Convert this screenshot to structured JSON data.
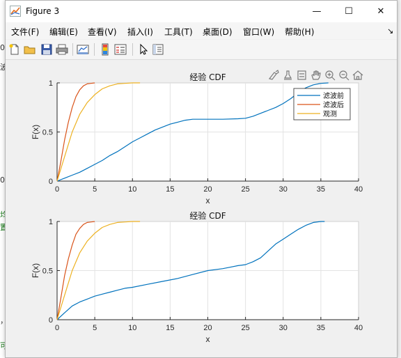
{
  "background": {
    "left_fragments": [
      "0",
      "波",
      "0",
      "均",
      "置",
      "，",
      "可"
    ]
  },
  "window": {
    "title": "Figure 3",
    "controls": {
      "minimize": "—",
      "maximize": "☐",
      "close": "✕"
    }
  },
  "menubar": {
    "items": [
      "文件(F)",
      "编辑(E)",
      "查看(V)",
      "插入(I)",
      "工具(T)",
      "桌面(D)",
      "窗口(W)",
      "帮助(H)"
    ],
    "overflow": "↘"
  },
  "toolbar": {
    "icons": [
      "new-figure-icon",
      "open-file-icon",
      "save-icon",
      "print-icon",
      "link-plot-icon",
      "insert-colorbar-icon",
      "insert-legend-icon",
      "edit-plot-arrow-icon",
      "property-inspector-icon"
    ]
  },
  "axes_toolbar": {
    "icons": [
      "brush-icon",
      "data-tips-icon",
      "zoom-select-icon",
      "pan-icon",
      "zoom-in-icon",
      "zoom-out-icon",
      "home-icon"
    ]
  },
  "colors": {
    "before": "#0072BD",
    "after": "#D95319",
    "observed": "#EDB120"
  },
  "chart_data": [
    {
      "type": "line",
      "title": "经验 CDF",
      "xlabel": "x",
      "ylabel": "F(x)",
      "xlim": [
        0,
        40
      ],
      "ylim": [
        0,
        1
      ],
      "xticks": [
        "0",
        "5",
        "10",
        "15",
        "20",
        "25",
        "30",
        "35",
        "40"
      ],
      "yticks": [
        "0",
        "0.5",
        "1"
      ],
      "grid": true,
      "legend": {
        "placement": "top-right",
        "entries": [
          "滤波前",
          "滤波后",
          "观测"
        ]
      },
      "series": [
        {
          "name": "滤波前",
          "color": "#0072BD",
          "x": [
            0,
            1,
            2,
            3,
            4,
            5,
            6,
            7,
            8,
            9,
            10,
            11,
            12,
            13,
            14,
            15,
            16,
            17,
            18,
            20,
            22,
            24,
            25,
            26,
            27,
            28,
            29,
            30,
            31,
            32,
            33,
            34,
            35,
            36
          ],
          "y": [
            0,
            0.03,
            0.06,
            0.09,
            0.13,
            0.17,
            0.21,
            0.26,
            0.3,
            0.35,
            0.4,
            0.44,
            0.48,
            0.52,
            0.55,
            0.58,
            0.6,
            0.62,
            0.63,
            0.63,
            0.63,
            0.635,
            0.64,
            0.66,
            0.69,
            0.72,
            0.75,
            0.79,
            0.84,
            0.9,
            0.95,
            0.98,
            0.995,
            1.0
          ]
        },
        {
          "name": "滤波后",
          "color": "#D95319",
          "x": [
            0,
            0.5,
            1,
            1.5,
            2,
            2.5,
            3,
            3.5,
            4,
            4.5,
            5
          ],
          "y": [
            0,
            0.2,
            0.42,
            0.6,
            0.75,
            0.86,
            0.93,
            0.97,
            0.99,
            0.995,
            1.0
          ]
        },
        {
          "name": "观测",
          "color": "#EDB120",
          "x": [
            0,
            1,
            2,
            3,
            4,
            5,
            6,
            7,
            8,
            9,
            10,
            11
          ],
          "y": [
            0,
            0.25,
            0.5,
            0.68,
            0.8,
            0.88,
            0.94,
            0.97,
            0.99,
            0.995,
            1.0,
            1.0
          ]
        }
      ]
    },
    {
      "type": "line",
      "title": "经验 CDF",
      "xlabel": "x",
      "ylabel": "F(x)",
      "xlim": [
        0,
        40
      ],
      "ylim": [
        0,
        1
      ],
      "xticks": [
        "0",
        "5",
        "10",
        "15",
        "20",
        "25",
        "30",
        "35",
        "40"
      ],
      "yticks": [
        "0",
        "0.5",
        "1"
      ],
      "grid": true,
      "series": [
        {
          "color": "#0072BD",
          "x": [
            0,
            1,
            2,
            3,
            4,
            5,
            6,
            7,
            8,
            9,
            10,
            12,
            14,
            16,
            18,
            20,
            22,
            24,
            25,
            26,
            27,
            28,
            29,
            30,
            31,
            32,
            33,
            34,
            35,
            35.5
          ],
          "y": [
            0,
            0.07,
            0.14,
            0.18,
            0.21,
            0.24,
            0.26,
            0.28,
            0.3,
            0.32,
            0.33,
            0.36,
            0.39,
            0.42,
            0.46,
            0.5,
            0.52,
            0.55,
            0.56,
            0.59,
            0.63,
            0.7,
            0.77,
            0.82,
            0.87,
            0.92,
            0.96,
            0.99,
            1.0,
            1.0
          ]
        },
        {
          "color": "#D95319",
          "x": [
            0,
            0.5,
            1,
            1.5,
            2,
            2.5,
            3,
            3.5,
            4,
            4.5,
            5
          ],
          "y": [
            0,
            0.22,
            0.45,
            0.62,
            0.76,
            0.87,
            0.93,
            0.97,
            0.99,
            0.995,
            1.0
          ]
        },
        {
          "color": "#EDB120",
          "x": [
            0,
            1,
            2,
            3,
            4,
            5,
            6,
            7,
            8,
            9,
            10,
            11
          ],
          "y": [
            0,
            0.25,
            0.5,
            0.68,
            0.8,
            0.88,
            0.94,
            0.97,
            0.99,
            0.995,
            1.0,
            1.0
          ]
        }
      ]
    }
  ]
}
